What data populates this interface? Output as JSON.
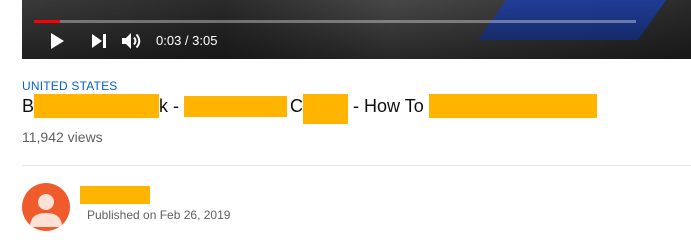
{
  "player": {
    "progress_fraction": 0.043,
    "time": "0:03 / 3:05",
    "accent_color": "#ff0000",
    "controls": [
      "play-icon",
      "next-icon",
      "volume-icon"
    ]
  },
  "video": {
    "hashtag": "UNITED STATES",
    "title_parts": [
      "B",
      "k - ",
      "C",
      " - How To "
    ],
    "views": "11,942 views"
  },
  "channel": {
    "avatar_color": "#ef5b2b",
    "published": "Published on Feb 26, 2019"
  },
  "colors": {
    "redaction": "#ffb400",
    "link": "#065fd4"
  }
}
